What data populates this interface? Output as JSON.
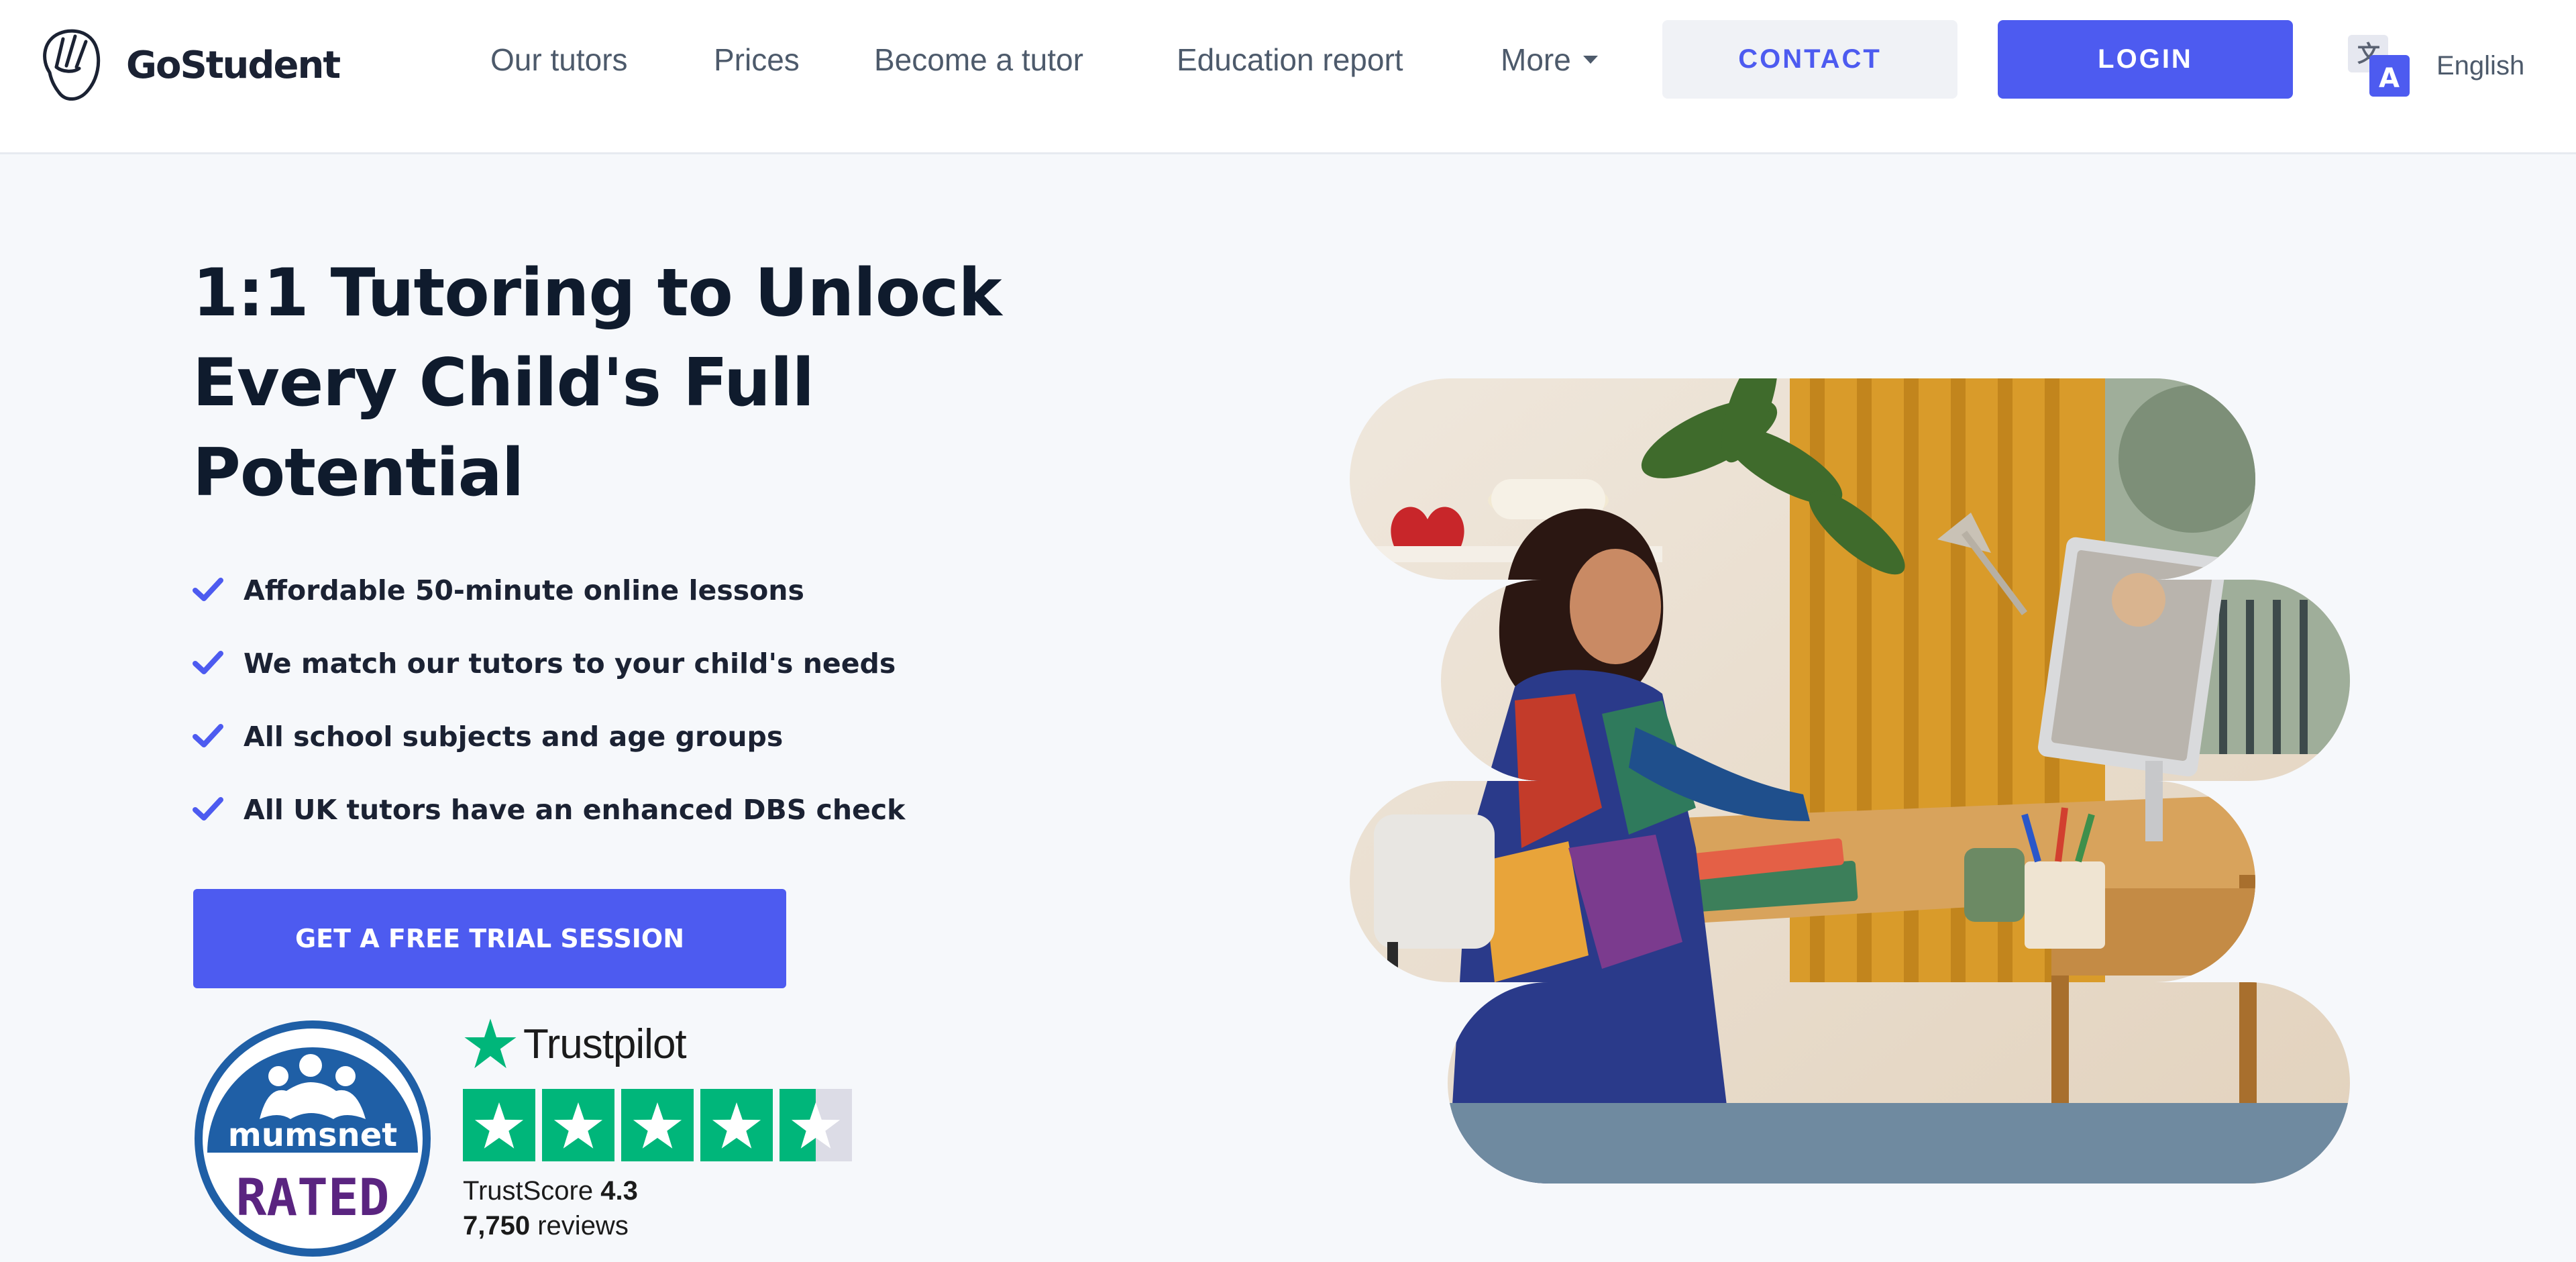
{
  "header": {
    "logo_text": "GoStudent",
    "nav": [
      "Our tutors",
      "Prices",
      "Become a tutor",
      "Education report",
      "More"
    ],
    "contact_label": "CONTACT",
    "login_label": "LOGIN",
    "language_label": "English"
  },
  "hero": {
    "title": "1:1 Tutoring to Unlock Every Child's Full Potential",
    "features": [
      "Affordable 50-minute online lessons",
      "We match our tutors to your child's needs",
      "All school subjects and age groups",
      "All UK tutors have an enhanced DBS check"
    ],
    "cta_label": "GET A FREE TRIAL SESSION"
  },
  "mumsnet": {
    "word": "mumsnet",
    "rated": "RATED"
  },
  "trustpilot": {
    "name": "Trustpilot",
    "score_label": "TrustScore",
    "score": "4.3",
    "score_value": 4.3,
    "reviews_count": "7,750",
    "reviews_label": "reviews"
  },
  "colors": {
    "accent": "#4d5bf0",
    "trustpilot_green": "#00b67a",
    "mumsnet_blue": "#1f5fa6",
    "mumsnet_purple": "#5a2480",
    "heading": "#0f1b2d",
    "nav_text": "#4d5a6b"
  },
  "icons": {
    "logo": "gostudent-hand-logo-icon",
    "language": "translate-icon",
    "feature": "checkmark-icon",
    "trustpilot": "trustpilot-star-icon"
  }
}
